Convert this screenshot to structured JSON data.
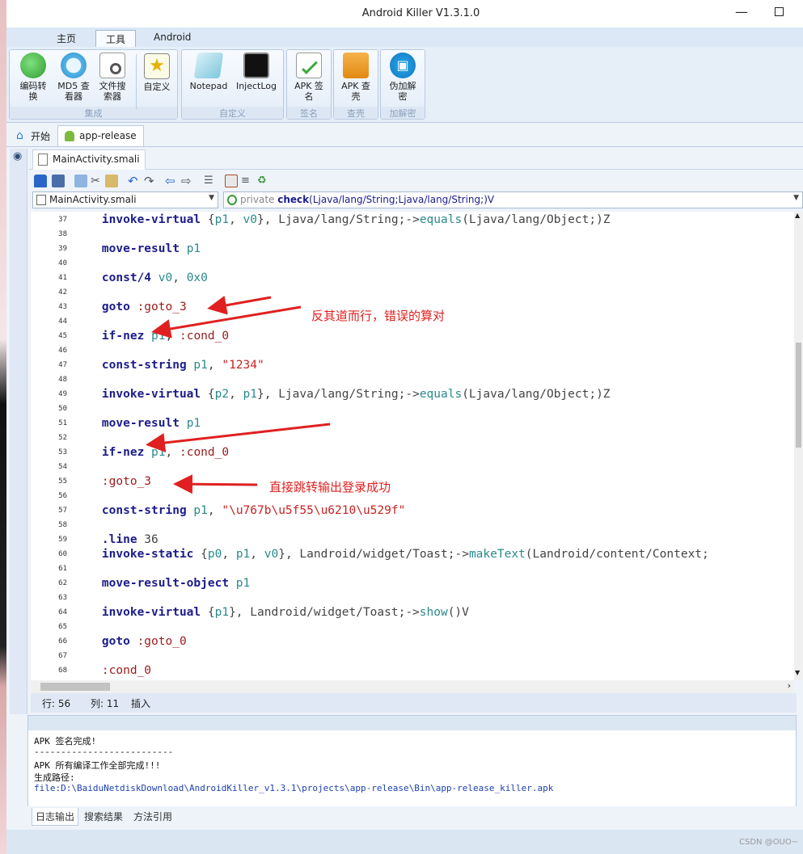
{
  "window": {
    "title": "Android Killer V1.3.1.0"
  },
  "ribbon_tabs": [
    "主页",
    "工具",
    "Android"
  ],
  "ribbon": {
    "groups": [
      {
        "label": "集成",
        "tools": [
          {
            "label": "编码转\n换",
            "icon": "code-convert-icon"
          },
          {
            "label": "MD5 查\n看器",
            "icon": "md5-icon"
          },
          {
            "label": "文件搜\n索器",
            "icon": "file-search-icon"
          }
        ]
      },
      {
        "label": "",
        "tools": [
          {
            "label": "自定义",
            "icon": "custom-star-icon"
          }
        ]
      },
      {
        "label": "自定义",
        "tools": [
          {
            "label": "Notepad",
            "icon": "notepad-icon"
          },
          {
            "label": "InjectLog",
            "icon": "terminal-icon"
          }
        ]
      },
      {
        "label": "签名",
        "tools": [
          {
            "label": "APK 签\n名",
            "icon": "sign-icon"
          }
        ]
      },
      {
        "label": "查壳",
        "tools": [
          {
            "label": "APK 查\n壳",
            "icon": "toolbox-icon"
          }
        ]
      },
      {
        "label": "加解密",
        "tools": [
          {
            "label": "伪加解\n密",
            "icon": "lock-icon"
          }
        ]
      }
    ]
  },
  "doc_tabs": [
    "开始",
    "app-release"
  ],
  "file_tab": "MainActivity.smali",
  "class_selector": "MainActivity.smali",
  "method_selector": {
    "modifier": "private",
    "name": "check",
    "signature": "(Ljava/lang/String;Ljava/lang/String;)V"
  },
  "code_lines": [
    {
      "n": "37",
      "t": "    invoke-virtual {p1, v0}, Ljava/lang/String;->equals(Ljava/lang/Object;)Z"
    },
    {
      "n": "38",
      "t": ""
    },
    {
      "n": "39",
      "t": "    move-result p1"
    },
    {
      "n": "40",
      "t": ""
    },
    {
      "n": "41",
      "t": "    const/4 v0, 0x0"
    },
    {
      "n": "42",
      "t": ""
    },
    {
      "n": "43",
      "t": "    goto :goto_3"
    },
    {
      "n": "44",
      "t": ""
    },
    {
      "n": "45",
      "t": "    if-nez p1, :cond_0"
    },
    {
      "n": "46",
      "t": ""
    },
    {
      "n": "47",
      "t": "    const-string p1, \"1234\""
    },
    {
      "n": "48",
      "t": ""
    },
    {
      "n": "49",
      "t": "    invoke-virtual {p2, p1}, Ljava/lang/String;->equals(Ljava/lang/Object;)Z"
    },
    {
      "n": "50",
      "t": ""
    },
    {
      "n": "51",
      "t": "    move-result p1"
    },
    {
      "n": "52",
      "t": ""
    },
    {
      "n": "53",
      "t": "    if-nez p1, :cond_0"
    },
    {
      "n": "54",
      "t": ""
    },
    {
      "n": "55",
      "t": "    :goto_3"
    },
    {
      "n": "56",
      "t": ""
    },
    {
      "n": "57",
      "t": "    const-string p1, \"\\u767b\\u5f55\\u6210\\u529f\""
    },
    {
      "n": "58",
      "t": ""
    },
    {
      "n": "59",
      "t": "    .line 36"
    },
    {
      "n": "60",
      "t": "    invoke-static {p0, p1, v0}, Landroid/widget/Toast;->makeText(Landroid/content/Context;"
    },
    {
      "n": "61",
      "t": ""
    },
    {
      "n": "62",
      "t": "    move-result-object p1"
    },
    {
      "n": "63",
      "t": ""
    },
    {
      "n": "64",
      "t": "    invoke-virtual {p1}, Landroid/widget/Toast;->show()V"
    },
    {
      "n": "65",
      "t": ""
    },
    {
      "n": "66",
      "t": "    goto :goto_0"
    },
    {
      "n": "67",
      "t": ""
    },
    {
      "n": "68",
      "t": "    :cond_0"
    }
  ],
  "annotations": {
    "note1": "反其道而行，错误的算对",
    "note2": "直接跳转输出登录成功",
    "color": "#e02020"
  },
  "status": {
    "row_label": "行: 56",
    "col_label": "列: 11",
    "mode": "插入"
  },
  "log": [
    "APK 签名完成!",
    "--------------------------",
    "APK 所有编译工作全部完成!!!",
    "生成路径:",
    "file:D:\\BaiduNetdiskDownload\\AndroidKiller_v1.3.1\\projects\\app-release\\Bin\\app-release_killer.apk"
  ],
  "bottom_tabs": [
    "日志输出",
    "搜索结果",
    "方法引用"
  ],
  "watermark": "CSDN @OUO~"
}
